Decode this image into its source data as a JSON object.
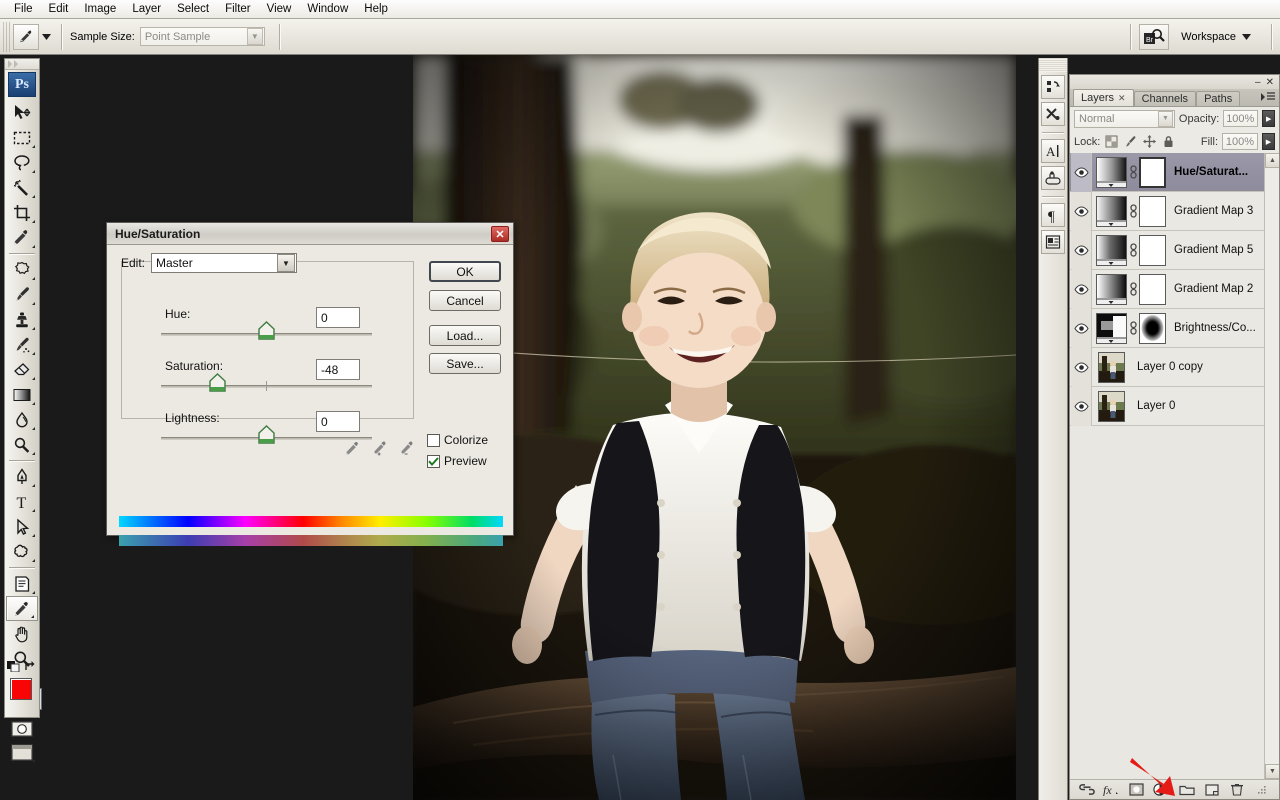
{
  "menubar": {
    "items": [
      "File",
      "Edit",
      "Image",
      "Layer",
      "Select",
      "Filter",
      "View",
      "Window",
      "Help"
    ]
  },
  "optionsbar": {
    "tool_icon": "eyedropper-icon",
    "sample_size_label": "Sample Size:",
    "sample_size_value": "Point Sample",
    "bridge_label": "Br",
    "workspace_label": "Workspace"
  },
  "toolbar": {
    "logo": "Ps",
    "tools": [
      {
        "name": "move-tool",
        "icon": "move-icon"
      },
      {
        "name": "marquee-tool",
        "icon": "rectangular-marquee-icon"
      },
      {
        "name": "lasso-tool",
        "icon": "lasso-icon"
      },
      {
        "name": "magic-wand-tool",
        "icon": "magic-wand-icon"
      },
      {
        "name": "crop-tool",
        "icon": "crop-icon"
      },
      {
        "name": "slice-tool",
        "icon": "slice-icon"
      },
      {
        "name": "healing-brush-tool",
        "icon": "healing-brush-icon"
      },
      {
        "name": "brush-tool",
        "icon": "paintbrush-icon"
      },
      {
        "name": "clone-stamp-tool",
        "icon": "clone-stamp-icon"
      },
      {
        "name": "history-brush-tool",
        "icon": "history-brush-icon"
      },
      {
        "name": "eraser-tool",
        "icon": "eraser-icon"
      },
      {
        "name": "gradient-tool",
        "icon": "gradient-icon"
      },
      {
        "name": "blur-tool",
        "icon": "blur-drop-icon"
      },
      {
        "name": "dodge-tool",
        "icon": "dodge-icon"
      },
      {
        "name": "pen-tool",
        "icon": "pen-nib-icon"
      },
      {
        "name": "type-tool",
        "icon": "text-t-icon"
      },
      {
        "name": "path-selection-tool",
        "icon": "path-arrow-icon"
      },
      {
        "name": "shape-tool",
        "icon": "custom-shape-icon"
      },
      {
        "name": "notes-tool",
        "icon": "notes-icon"
      },
      {
        "name": "eyedropper-tool",
        "icon": "eyedropper-icon",
        "selected": true
      },
      {
        "name": "hand-tool",
        "icon": "hand-icon"
      },
      {
        "name": "zoom-tool",
        "icon": "magnifier-icon"
      }
    ],
    "foreground_color": "#f90505",
    "background_color": "#cfdde8",
    "quick_mask_icon": "quick-mask-icon",
    "screen_mode_icon": "screen-mode-icon"
  },
  "icondock": {
    "items": [
      {
        "name": "history-panel-icon",
        "icon": "history-icon"
      },
      {
        "name": "tool-presets-panel-icon",
        "icon": "tools-cross-icon"
      },
      {
        "name": "character-panel-icon",
        "icon": "character-a-icon"
      },
      {
        "name": "brushes-panel-icon",
        "icon": "brushes-icon"
      },
      {
        "name": "paragraph-panel-icon",
        "icon": "pilcrow-icon"
      },
      {
        "name": "layer-comps-panel-icon",
        "icon": "layer-comps-icon"
      }
    ]
  },
  "layers_panel": {
    "tabs": [
      {
        "label": "Layers",
        "active": true,
        "closable": true
      },
      {
        "label": "Channels",
        "active": false,
        "closable": false
      },
      {
        "label": "Paths",
        "active": false,
        "closable": false
      }
    ],
    "blend_mode": "Normal",
    "opacity_label": "Opacity:",
    "opacity_value": "100%",
    "lock_label": "Lock:",
    "fill_label": "Fill:",
    "fill_value": "100%",
    "lock_icons": [
      "lock-transparency-icon",
      "lock-image-icon",
      "lock-position-icon",
      "lock-all-icon"
    ],
    "layers": [
      {
        "name": "Hue/Saturat...",
        "type": "adjustment-gradient",
        "visible": true,
        "selected": true,
        "linked": true,
        "mask": "white"
      },
      {
        "name": "Gradient Map 3",
        "type": "adjustment-gradient",
        "visible": true,
        "selected": false,
        "linked": true,
        "mask": "white"
      },
      {
        "name": "Gradient Map 5",
        "type": "adjustment-gradient",
        "visible": true,
        "selected": false,
        "linked": true,
        "mask": "white"
      },
      {
        "name": "Gradient Map 2",
        "type": "adjustment-gradient",
        "visible": true,
        "selected": false,
        "linked": true,
        "mask": "white"
      },
      {
        "name": "Brightness/Co...",
        "type": "adjustment-brightness",
        "visible": true,
        "selected": false,
        "linked": true,
        "mask": "black-blob"
      },
      {
        "name": "Layer 0 copy",
        "type": "pixel",
        "visible": true,
        "selected": false,
        "linked": false,
        "mask": null
      },
      {
        "name": "Layer 0",
        "type": "pixel",
        "visible": true,
        "selected": false,
        "linked": false,
        "mask": null
      }
    ],
    "footer_icons": [
      {
        "name": "link-layers-icon",
        "icon": "chain-icon"
      },
      {
        "name": "layer-style-icon",
        "icon": "fx-icon"
      },
      {
        "name": "add-layer-mask-icon",
        "icon": "mask-circle-icon"
      },
      {
        "name": "new-adjustment-layer-icon",
        "icon": "half-circle-icon"
      },
      {
        "name": "new-group-icon",
        "icon": "folder-icon"
      },
      {
        "name": "new-layer-icon",
        "icon": "new-layer-icon"
      },
      {
        "name": "delete-layer-icon",
        "icon": "trash-icon"
      }
    ],
    "annotation": {
      "name": "red-arrow-annotation",
      "color": "#e41b17",
      "points_to": "new-adjustment-layer-icon"
    }
  },
  "dialog": {
    "title": "Hue/Saturation",
    "close_label": "✕",
    "edit_label": "Edit:",
    "edit_value": "Master",
    "sliders": [
      {
        "name": "Hue:",
        "value": "0",
        "knob_pct": 50
      },
      {
        "name": "Saturation:",
        "value": "-48",
        "knob_pct": 26
      },
      {
        "name": "Lightness:",
        "value": "0",
        "knob_pct": 50
      }
    ],
    "buttons": {
      "ok": "OK",
      "cancel": "Cancel",
      "load": "Load...",
      "save": "Save..."
    },
    "eyedroppers": [
      "eyedropper-icon",
      "eyedropper-plus-icon",
      "eyedropper-minus-icon"
    ],
    "colorize_label": "Colorize",
    "colorize_checked": false,
    "preview_label": "Preview",
    "preview_checked": true
  }
}
